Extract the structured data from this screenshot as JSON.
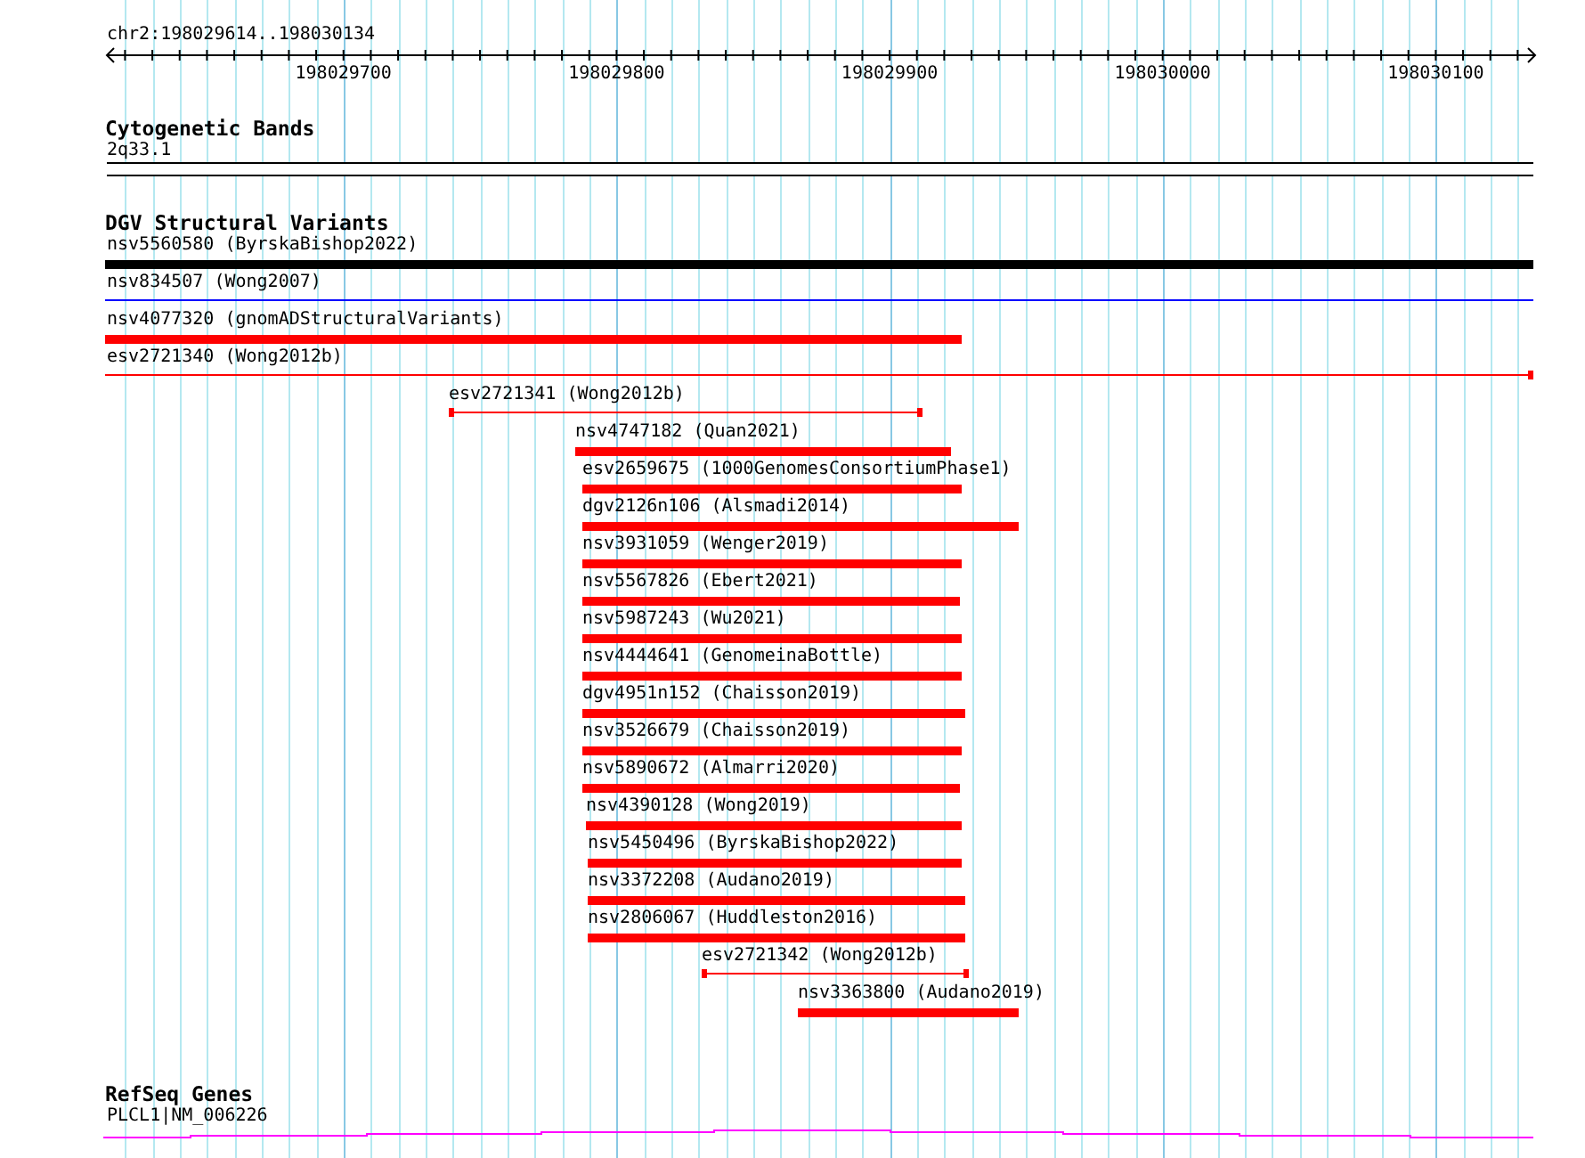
{
  "ruler": {
    "location": "chr2:198029614..198030134",
    "ticks": [
      "198029700",
      "198029800",
      "198029900",
      "198030000",
      "198030100"
    ]
  },
  "tracks": [
    {
      "kind": "cytoband",
      "title": "Cytogenetic Bands",
      "band": "2q33.1"
    },
    {
      "kind": "variants",
      "title": "DGV Structural Variants",
      "features": [
        {
          "label": "nsv5560580 (ByrskaBishop2022)",
          "kind": "bar",
          "color": "#000000"
        },
        {
          "label": "nsv834507 (Wong2007)",
          "kind": "line",
          "color": "#0000ff"
        },
        {
          "label": "nsv4077320 (gnomADStructuralVariants)",
          "kind": "bar",
          "color": "#ff0000"
        },
        {
          "label": "esv2721340 (Wong2012b)",
          "kind": "line",
          "color": "#ff0000"
        },
        {
          "label": "esv2721341 (Wong2012b)",
          "kind": "line",
          "color": "#ff0000"
        },
        {
          "label": "nsv4747182 (Quan2021)",
          "kind": "bar",
          "color": "#ff0000"
        },
        {
          "label": "esv2659675 (1000GenomesConsortiumPhase1)",
          "kind": "bar",
          "color": "#ff0000"
        },
        {
          "label": "dgv2126n106 (Alsmadi2014)",
          "kind": "bar",
          "color": "#ff0000"
        },
        {
          "label": "nsv3931059 (Wenger2019)",
          "kind": "bar",
          "color": "#ff0000"
        },
        {
          "label": "nsv5567826 (Ebert2021)",
          "kind": "bar",
          "color": "#ff0000"
        },
        {
          "label": "nsv5987243 (Wu2021)",
          "kind": "bar",
          "color": "#ff0000"
        },
        {
          "label": "nsv4444641 (GenomeinaBottle)",
          "kind": "bar",
          "color": "#ff0000"
        },
        {
          "label": "dgv4951n152 (Chaisson2019)",
          "kind": "bar",
          "color": "#ff0000"
        },
        {
          "label": "nsv3526679 (Chaisson2019)",
          "kind": "bar",
          "color": "#ff0000"
        },
        {
          "label": "nsv5890672 (Almarri2020)",
          "kind": "bar",
          "color": "#ff0000"
        },
        {
          "label": "nsv4390128 (Wong2019)",
          "kind": "bar",
          "color": "#ff0000"
        },
        {
          "label": "nsv5450496 (ByrskaBishop2022)",
          "kind": "bar",
          "color": "#ff0000"
        },
        {
          "label": "nsv3372208 (Audano2019)",
          "kind": "bar",
          "color": "#ff0000"
        },
        {
          "label": "nsv2806067 (Huddleston2016)",
          "kind": "bar",
          "color": "#ff0000"
        },
        {
          "label": "esv2721342 (Wong2012b)",
          "kind": "line",
          "color": "#ff0000"
        },
        {
          "label": "nsv3363800 (Audano2019)",
          "kind": "bar",
          "color": "#ff0000"
        }
      ]
    },
    {
      "kind": "genes",
      "title": "RefSeq Genes",
      "gene": "PLCL1|NM_006226"
    }
  ]
}
